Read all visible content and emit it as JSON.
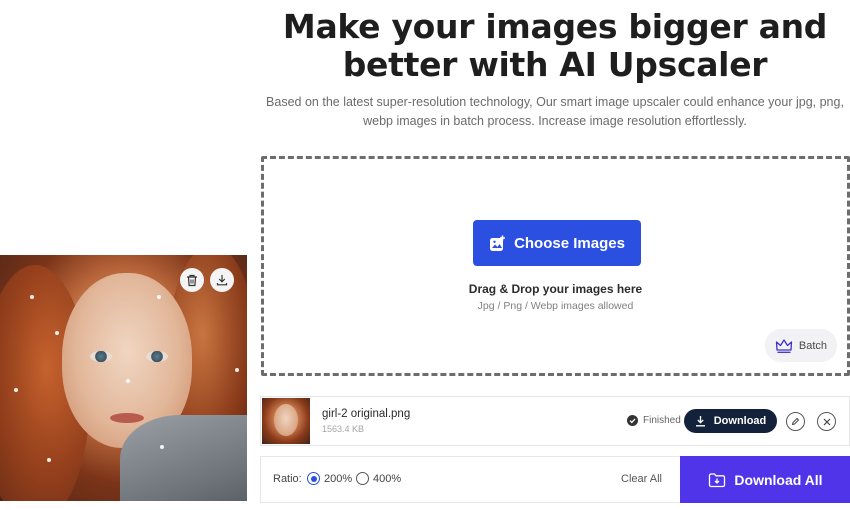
{
  "hero": {
    "title_line1": "Make your images bigger and",
    "title_line2": "better with AI Upscaler",
    "subtitle_line1": "Based on the latest super-resolution technology, Our smart image upscaler could enhance your jpg, png,",
    "subtitle_line2": "webp images in batch process. Increase image resolution effortlessly."
  },
  "preview": {
    "delete_icon": "trash-icon",
    "download_icon": "download-icon"
  },
  "uploader": {
    "choose_label": "Choose Images",
    "drag_text": "Drag & Drop your images here",
    "allowed_text": "Jpg / Png / Webp images allowed",
    "batch_label": "Batch"
  },
  "file": {
    "name": "girl-2 original.png",
    "size": "1563.4 KB",
    "status": "Finished",
    "download_label": "Download"
  },
  "controls": {
    "ratio_label": "Ratio:",
    "options": [
      "200%",
      "400%"
    ],
    "selected": "200%",
    "clear_all_label": "Clear All",
    "download_all_label": "Download All"
  },
  "colors": {
    "primary_blue": "#2b4fe0",
    "download_all_purple": "#4f34ea",
    "dark_button": "#14213a"
  }
}
